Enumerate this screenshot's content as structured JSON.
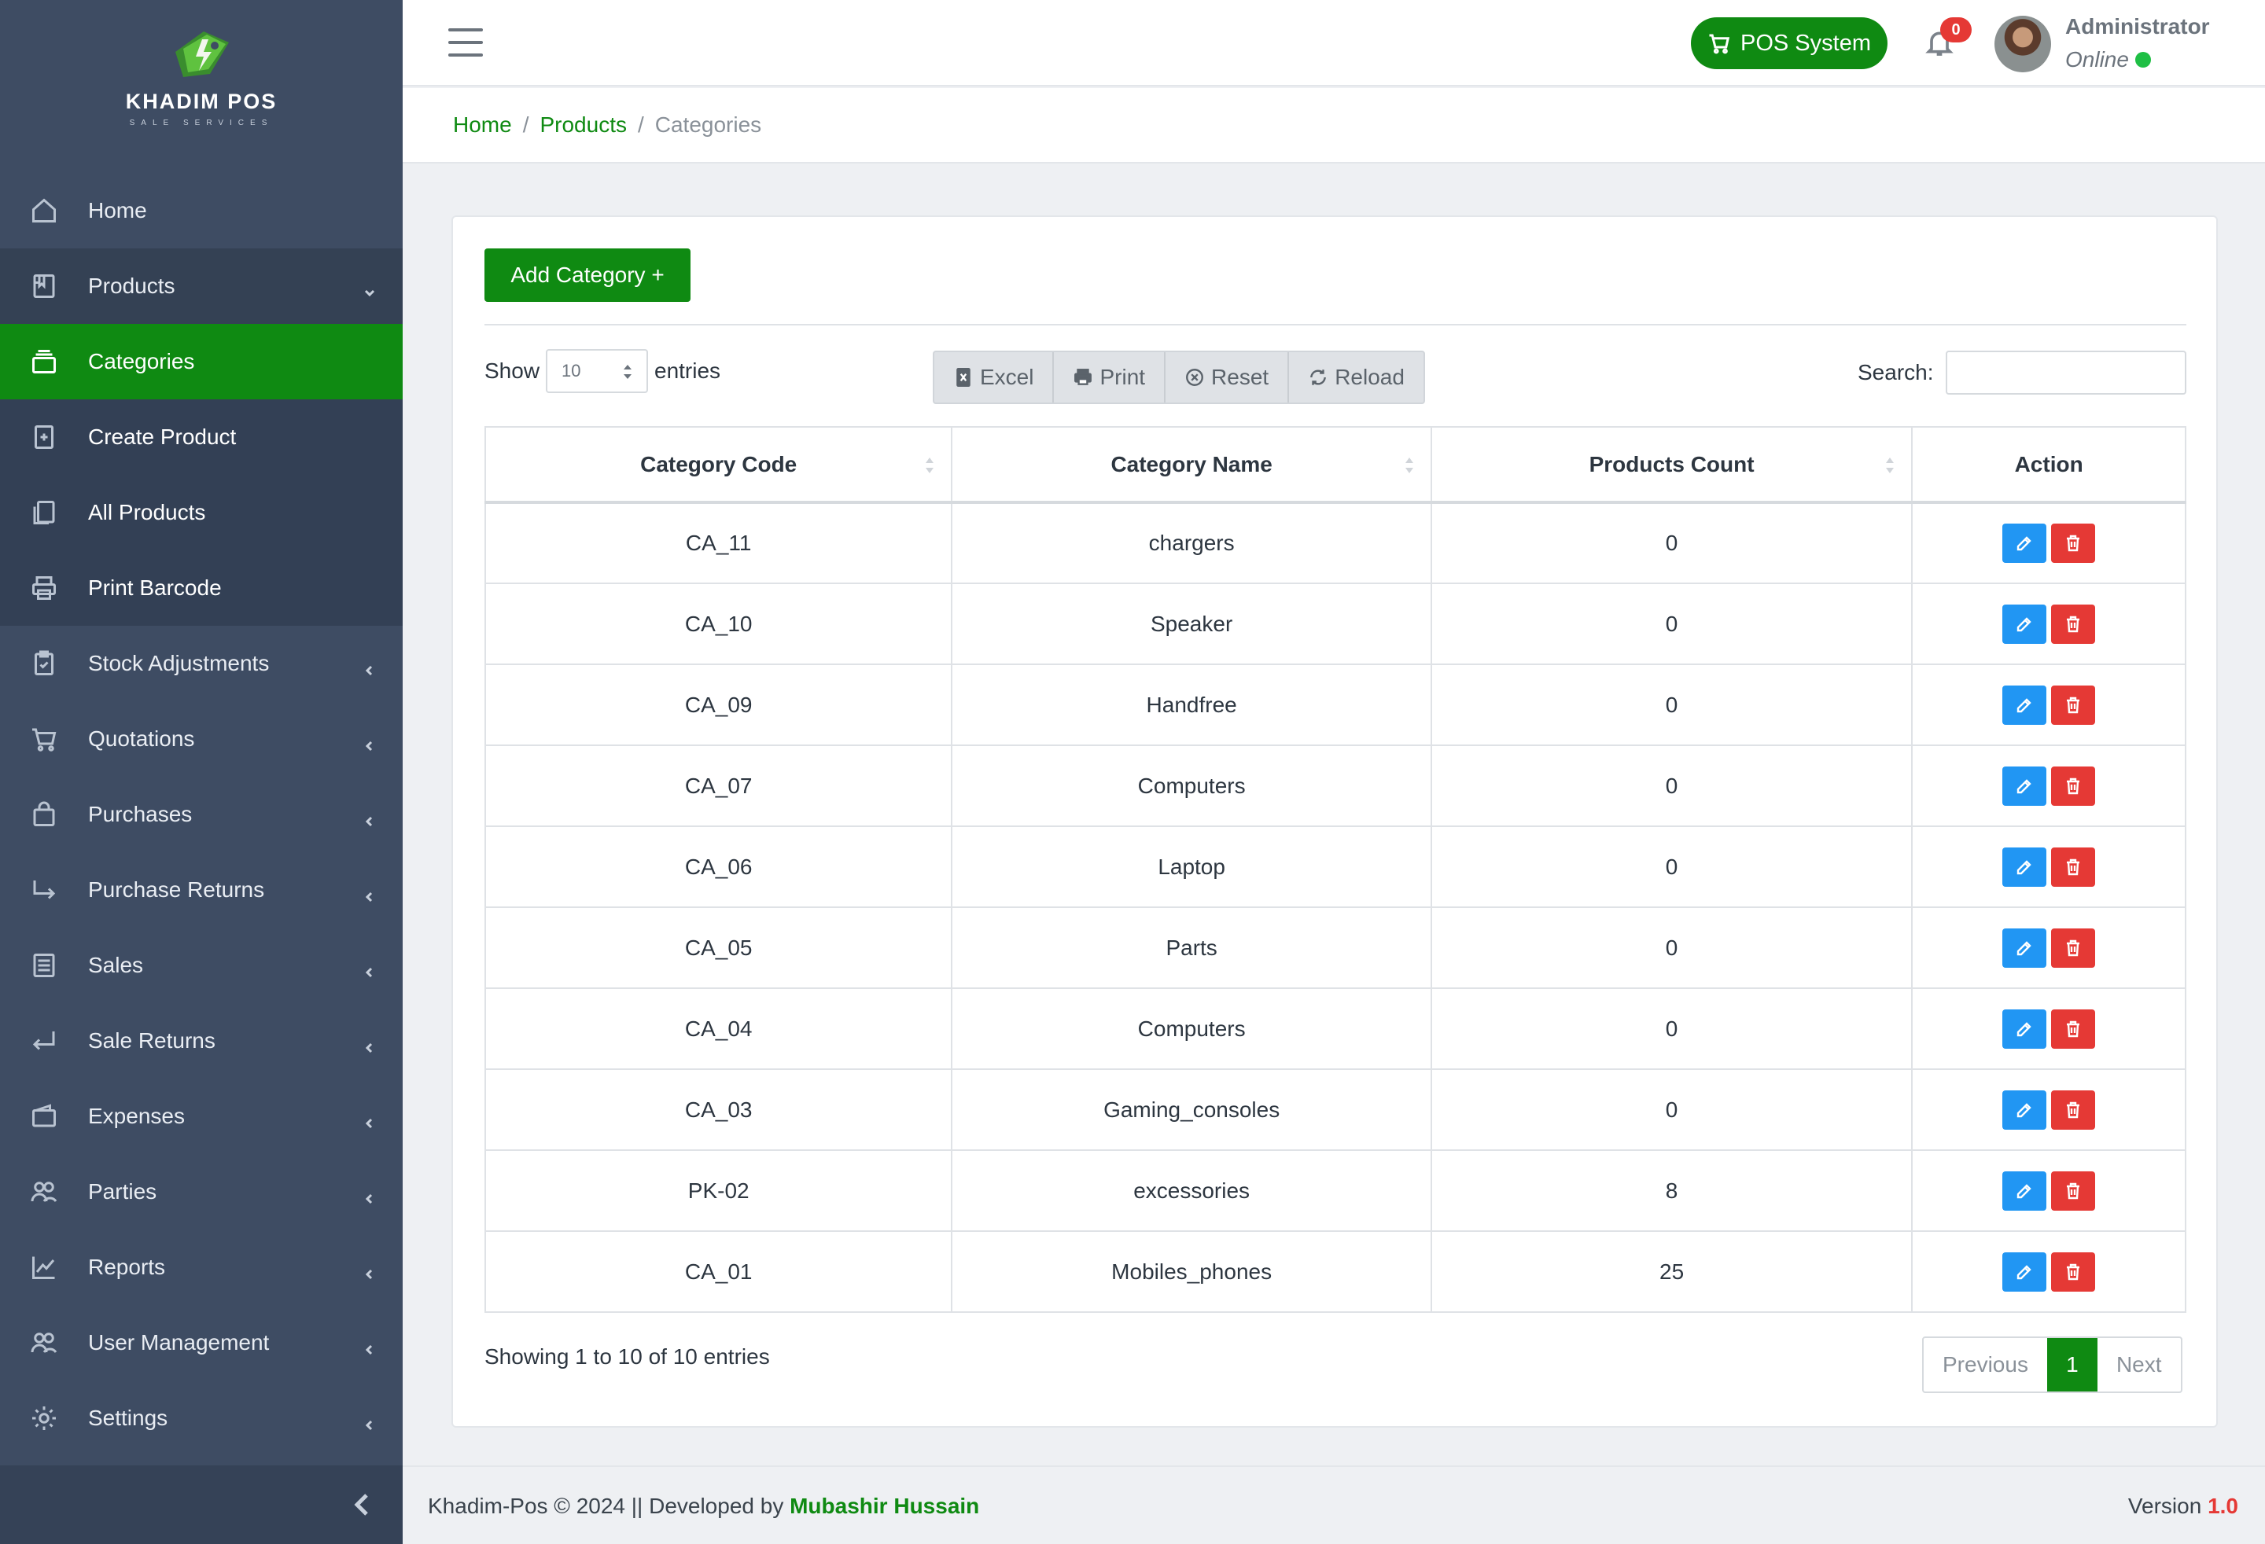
{
  "brand": {
    "name": "KHADIM POS",
    "tagline": "SALE SERVICES"
  },
  "sidebar": {
    "items": [
      {
        "label": "Home",
        "icon": "home-icon",
        "arrow": ""
      },
      {
        "label": "Products",
        "icon": "book-icon",
        "arrow": "chevron-down-icon"
      },
      {
        "label": "Categories",
        "icon": "stack-icon",
        "arrow": ""
      },
      {
        "label": "Create Product",
        "icon": "add-doc-icon",
        "arrow": ""
      },
      {
        "label": "All Products",
        "icon": "copy-icon",
        "arrow": ""
      },
      {
        "label": "Print Barcode",
        "icon": "printer-icon",
        "arrow": ""
      },
      {
        "label": "Stock Adjustments",
        "icon": "clipboard-icon",
        "arrow": "chevron-left-icon"
      },
      {
        "label": "Quotations",
        "icon": "cart-icon",
        "arrow": "chevron-left-icon"
      },
      {
        "label": "Purchases",
        "icon": "bag-icon",
        "arrow": "chevron-left-icon"
      },
      {
        "label": "Purchase Returns",
        "icon": "return-right-icon",
        "arrow": "chevron-left-icon"
      },
      {
        "label": "Sales",
        "icon": "list-icon",
        "arrow": "chevron-left-icon"
      },
      {
        "label": "Sale Returns",
        "icon": "return-left-icon",
        "arrow": "chevron-left-icon"
      },
      {
        "label": "Expenses",
        "icon": "wallet-icon",
        "arrow": "chevron-left-icon"
      },
      {
        "label": "Parties",
        "icon": "users-icon",
        "arrow": "chevron-left-icon"
      },
      {
        "label": "Reports",
        "icon": "chart-icon",
        "arrow": "chevron-left-icon"
      },
      {
        "label": "User Management",
        "icon": "users-icon",
        "arrow": "chevron-left-icon"
      },
      {
        "label": "Settings",
        "icon": "gear-icon",
        "arrow": "chevron-left-icon"
      }
    ]
  },
  "header": {
    "pos_label": "POS System",
    "notification_count": "0",
    "user_name": "Administrator",
    "user_status": "Online"
  },
  "breadcrumb": {
    "home": "Home",
    "section": "Products",
    "current": "Categories"
  },
  "toolbar": {
    "add_label": "Add Category  +",
    "show_label": "Show",
    "page_size": "10",
    "entries_label": "entries",
    "buttons": [
      "Excel",
      "Print",
      "Reset",
      "Reload"
    ],
    "search_label": "Search:",
    "search_value": ""
  },
  "table": {
    "columns": [
      "Category Code",
      "Category Name",
      "Products Count",
      "Action"
    ],
    "rows": [
      {
        "code": "CA_11",
        "name": "chargers",
        "count": "0"
      },
      {
        "code": "CA_10",
        "name": "Speaker",
        "count": "0"
      },
      {
        "code": "CA_09",
        "name": "Handfree",
        "count": "0"
      },
      {
        "code": "CA_07",
        "name": "Computers",
        "count": "0"
      },
      {
        "code": "CA_06",
        "name": "Laptop",
        "count": "0"
      },
      {
        "code": "CA_05",
        "name": "Parts",
        "count": "0"
      },
      {
        "code": "CA_04",
        "name": "Computers",
        "count": "0"
      },
      {
        "code": "CA_03",
        "name": "Gaming_consoles",
        "count": "0"
      },
      {
        "code": "PK-02",
        "name": "excessories",
        "count": "8"
      },
      {
        "code": "CA_01",
        "name": "Mobiles_phones",
        "count": "25"
      }
    ]
  },
  "pagination": {
    "info": "Showing 1 to 10 of 10 entries",
    "previous": "Previous",
    "current": "1",
    "next": "Next"
  },
  "footer": {
    "text": "Khadim-Pos © 2024 || Developed by ",
    "developer": "Mubashir Hussain",
    "version_label": "Version ",
    "version": "1.0"
  },
  "colors": {
    "primary": "#0f8a12",
    "sidebar": "#3e4c63",
    "edit": "#2196f3",
    "delete": "#e53935"
  }
}
